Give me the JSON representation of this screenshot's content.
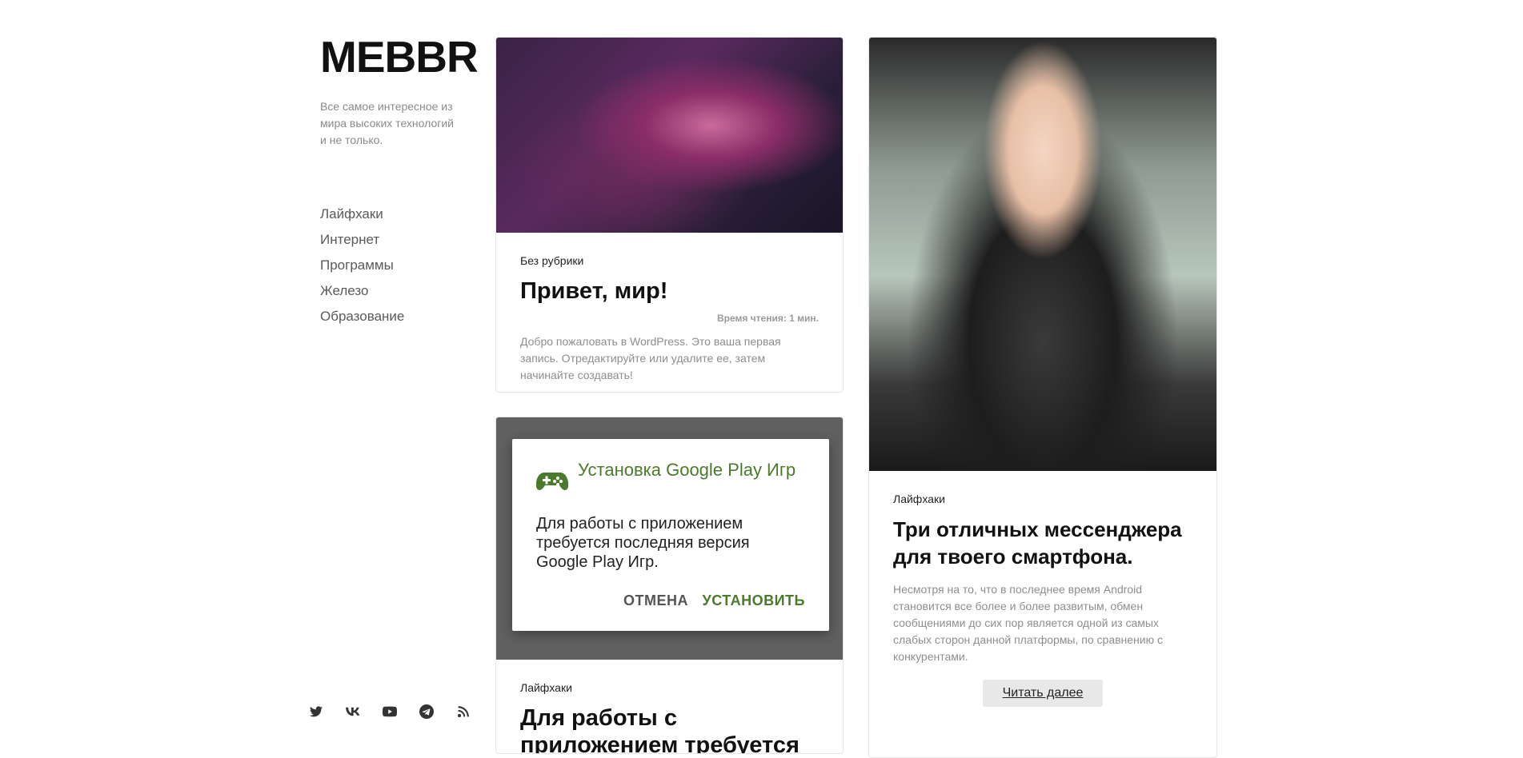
{
  "site": {
    "logo": "MEBBR",
    "tagline": "Все самое интересное из мира высоких технологий и не только."
  },
  "nav": {
    "items": [
      {
        "label": "Лайфхаки"
      },
      {
        "label": "Интернет"
      },
      {
        "label": "Программы"
      },
      {
        "label": "Железо"
      },
      {
        "label": "Образование"
      }
    ]
  },
  "social": [
    "twitter-icon",
    "vk-icon",
    "youtube-icon",
    "telegram-icon",
    "rss-icon"
  ],
  "posts": [
    {
      "category": "Без рубрики",
      "title": "Привет, мир!",
      "read_time": "Время чтения: 1 мин.",
      "excerpt": "Добро пожаловать в WordPress. Это ваша первая запись. Отредактируйте или удалите ее, затем начинайте создавать!"
    },
    {
      "dialog": {
        "title": "Установка Google Play Игр",
        "body": "Для работы с приложением требуется последняя версия Google Play Игр.",
        "cancel": "ОТМЕНА",
        "install": "УСТАНОВИТЬ"
      },
      "category": "Лайфхаки",
      "title": "Для работы с приложением требуется"
    },
    {
      "category": "Лайфхаки",
      "title": "Три отличных мессенджера для твоего смартфона.",
      "excerpt": "Несмотря на то, что в последнее время Android становится все более и более развитым, обмен сообщениями до сих пор является одной из самых слабых сторон данной платформы, по сравнению с конкурентами.",
      "read_more": "Читать далее"
    }
  ],
  "colors": {
    "accent_green": "#4a7b2c",
    "text_muted": "#8e8e8e"
  }
}
